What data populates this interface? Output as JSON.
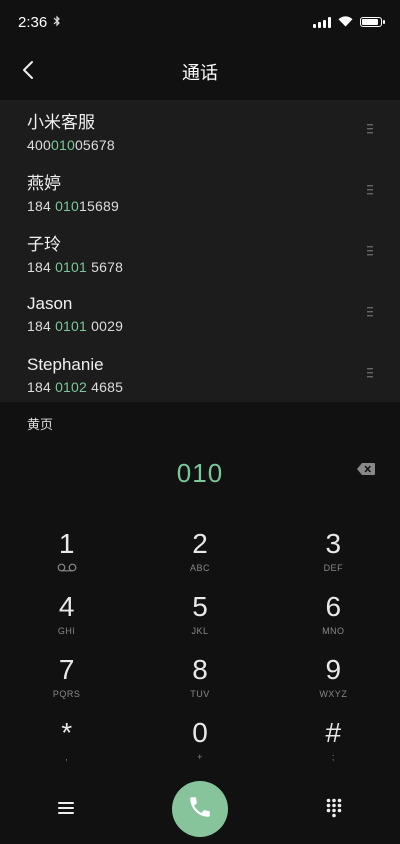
{
  "status_bar": {
    "time": "2:36",
    "bluetooth_icon": "bluetooth-icon",
    "signal_icon": "signal-icon",
    "wifi_icon": "wifi-icon",
    "battery_icon": "battery-icon"
  },
  "header": {
    "title": "通话",
    "back_icon": "chevron-left-icon"
  },
  "contacts": [
    {
      "name": "小米客服",
      "number_pre": "400",
      "number_match": "010",
      "number_post": "05678"
    },
    {
      "name": "燕婷",
      "number_pre": "184 ",
      "number_match": "010",
      "number_post": "15689"
    },
    {
      "name": "子玲",
      "number_pre": "184 ",
      "number_match": "0101",
      "number_post": " 5678"
    },
    {
      "name": "Jason",
      "number_pre": "184 ",
      "number_match": "0101",
      "number_post": " 0029"
    },
    {
      "name": "Stephanie",
      "number_pre": "184 ",
      "number_match": "0102",
      "number_post": " 4685"
    }
  ],
  "yellow_pages_label": "黄页",
  "dial": {
    "input": "010",
    "delete_icon": "backspace-icon"
  },
  "keypad": {
    "keys": [
      {
        "digit": "1",
        "sub": ""
      },
      {
        "digit": "2",
        "sub": "ABC"
      },
      {
        "digit": "3",
        "sub": "DEF"
      },
      {
        "digit": "4",
        "sub": "GHI"
      },
      {
        "digit": "5",
        "sub": "JKL"
      },
      {
        "digit": "6",
        "sub": "MNO"
      },
      {
        "digit": "7",
        "sub": "PQRS"
      },
      {
        "digit": "8",
        "sub": "TUV"
      },
      {
        "digit": "9",
        "sub": "WXYZ"
      },
      {
        "digit": "*",
        "sub": ","
      },
      {
        "digit": "0",
        "sub": "+"
      },
      {
        "digit": "#",
        "sub": ";"
      }
    ]
  },
  "bottom_bar": {
    "menu_icon": "menu-icon",
    "call_icon": "phone-icon",
    "keypad_icon": "dialpad-icon",
    "accent_color": "#87c49c"
  },
  "colors": {
    "background": "#111111",
    "list_background": "#1c1c1c",
    "match_highlight": "#7cc799"
  }
}
